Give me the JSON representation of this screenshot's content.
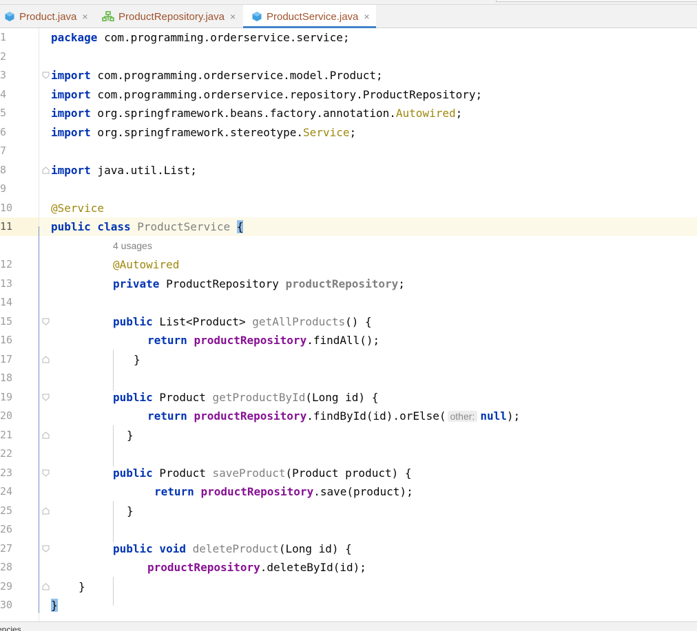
{
  "tabs": [
    {
      "label": "Product.java",
      "icon": "java-class-icon",
      "active": false
    },
    {
      "label": "ProductRepository.java",
      "icon": "interface-icon",
      "active": false
    },
    {
      "label": "ProductService.java",
      "icon": "java-class-icon",
      "active": true
    }
  ],
  "tab_close_glyph": "×",
  "line_numbers": [
    "1",
    "2",
    "3",
    "4",
    "5",
    "6",
    "7",
    "8",
    "9",
    "10",
    "11",
    "12",
    "13",
    "14",
    "15",
    "16",
    "17",
    "18",
    "19",
    "20",
    "21",
    "22",
    "23",
    "24",
    "25",
    "26",
    "27",
    "28",
    "29",
    "30"
  ],
  "code": {
    "l1_kw": "package",
    "l1_rest": " com.programming.orderservice.service;",
    "import_kw": "import",
    "l3_rest": " com.programming.orderservice.model.Product;",
    "l4_rest": " com.programming.orderservice.repository.ProductRepository;",
    "l5_a": " org.springframework.beans.factory.annotation.",
    "l5_ann": "Autowired",
    "l5_end": ";",
    "l6_a": " org.springframework.stereotype.",
    "l6_ann": "Service",
    "l6_end": ";",
    "l8_rest": " java.util.List;",
    "l10_ann": "@Service",
    "l11_kw": "public class",
    "l11_name": "ProductService",
    "l11_brace": "{",
    "usages_hint": "4 usages",
    "l12_ann": "@Autowired",
    "l13_kw": "private",
    "l13_type": " ProductRepository ",
    "l13_field": "productRepository",
    "l13_end": ";",
    "public_kw": "public",
    "return_kw": "return",
    "field": "productRepository",
    "l15_type": " List<Product> ",
    "l15_name": "getAllProducts",
    "l15_end": "() {",
    "l16_end": ".findAll();",
    "close_brace": "}",
    "l19_type": " Product ",
    "l19_name": "getProductById",
    "l19_end": "(Long id) {",
    "l20_a": ".findById(id).orElse(",
    "l20_hint": "other:",
    "l20_null": "null",
    "l20_end": ");",
    "l23_type": " Product ",
    "l23_name": "saveProduct",
    "l23_end": "(Product product) {",
    "l24_end": ".save(product);",
    "l27_kw": "public void",
    "l27_name": "deleteProduct",
    "l27_end": "(Long id) {",
    "l28_end": ".deleteById(id);"
  },
  "status": {
    "text": "encies"
  },
  "colors": {
    "keyword": "#0033b3",
    "annotation": "#9e880d",
    "field": "#871094",
    "unused": "#808080",
    "tab_text": "#a0522d",
    "tab_underline": "#4083c9"
  }
}
